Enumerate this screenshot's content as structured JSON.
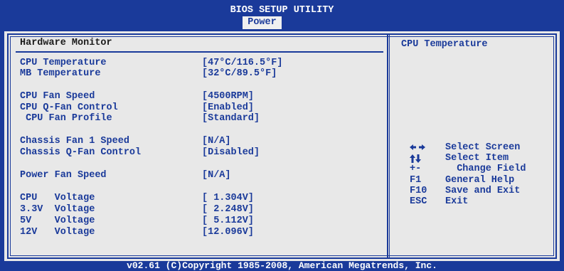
{
  "app": {
    "title": "BIOS SETUP UTILITY",
    "active_tab": "Power"
  },
  "section_title": "Hardware Monitor",
  "rows": [
    {
      "label": "CPU Temperature",
      "value": "[47°C/116.5°F]"
    },
    {
      "label": "MB Temperature",
      "value": "[32°C/89.5°F]"
    },
    {
      "label": "CPU Fan Speed",
      "value": "[4500RPM]"
    },
    {
      "label": "CPU Q-Fan Control",
      "value": "[Enabled]"
    },
    {
      "label": " CPU Fan Profile",
      "value": "[Standard]"
    },
    {
      "label": "Chassis Fan 1 Speed",
      "value": "[N/A]"
    },
    {
      "label": "Chassis Q-Fan Control",
      "value": "[Disabled]"
    },
    {
      "label": "Power Fan Speed",
      "value": "[N/A]"
    },
    {
      "label": "CPU   Voltage",
      "value": "[ 1.304V]"
    },
    {
      "label": "3.3V  Voltage",
      "value": "[ 2.248V]"
    },
    {
      "label": "5V    Voltage",
      "value": "[ 5.112V]"
    },
    {
      "label": "12V   Voltage",
      "value": "[12.096V]"
    }
  ],
  "help_title": "CPU Temperature",
  "keys": [
    {
      "key": "",
      "icon": "left-right-arrows-icon",
      "desc": "Select Screen"
    },
    {
      "key": "",
      "icon": "up-down-arrows-icon",
      "desc": "Select Item"
    },
    {
      "key": "+-",
      "icon": "",
      "desc": "  Change Field"
    },
    {
      "key": "F1",
      "icon": "",
      "desc": "General Help"
    },
    {
      "key": "F10",
      "icon": "",
      "desc": "Save and Exit"
    },
    {
      "key": "ESC",
      "icon": "",
      "desc": "Exit"
    }
  ],
  "footer": "v02.61 (C)Copyright 1985-2008, American Megatrends, Inc.",
  "colors": {
    "bios_blue": "#1a3a9a",
    "panel_gray": "#e8e8e8",
    "tab_bg": "#f0f0f0"
  }
}
